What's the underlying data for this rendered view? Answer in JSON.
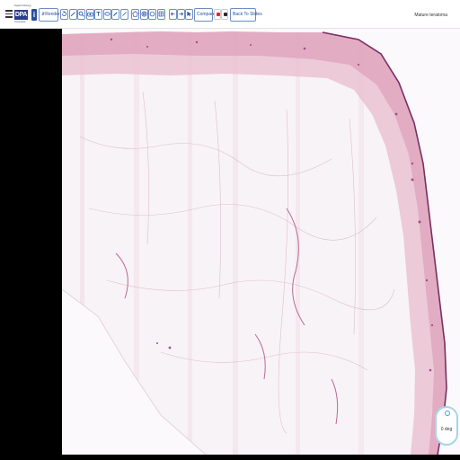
{
  "app": {
    "logo_text": "DPA",
    "logo_small_top": "Digital Pathology",
    "logo_small_bottom": "Association"
  },
  "toolbar": {
    "info_label": "i",
    "render_label": "Render",
    "compare_label": "Compare",
    "back_label": "Back To Slides",
    "tool_icons": [
      "rotate-left-icon",
      "pen-icon",
      "magnify-icon",
      "camera-icon",
      "ruler-icon",
      "ellipse-icon",
      "pencil-icon",
      "line-icon",
      "polygon-icon",
      "target-icon",
      "circle-icon",
      "grid-icon"
    ],
    "accent": "#2a4f9b",
    "record_color": "#e0242b"
  },
  "slide": {
    "title": "Mature teratoma"
  },
  "rotation": {
    "label": "0 deg"
  }
}
